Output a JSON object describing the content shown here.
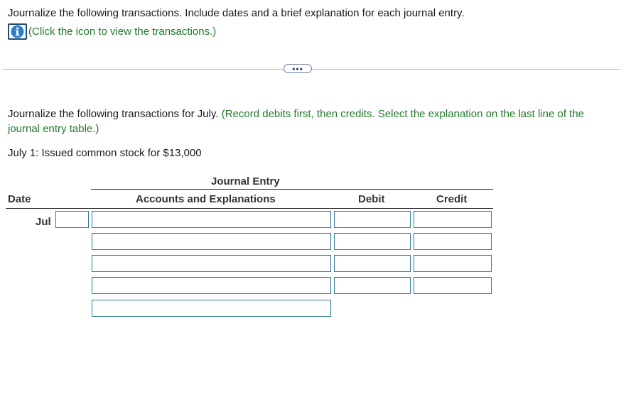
{
  "question": {
    "text": "Journalize the following transactions. Include dates and a brief explanation for each journal entry.",
    "info_link": "(Click the icon to view the transactions.)",
    "info_icon": "info-icon"
  },
  "more_button": {
    "label": "•••"
  },
  "instructions": {
    "text": "Journalize the following transactions for July.",
    "note": "(Record debits first, then credits. Select the explanation on the last line of the journal entry table.)"
  },
  "transaction": {
    "text": "July 1: Issued common stock for $13,000"
  },
  "journal": {
    "title": "Journal Entry",
    "col_date": "Date",
    "col_accounts": "Accounts and Explanations",
    "col_debit": "Debit",
    "col_credit": "Credit",
    "month": "Jul",
    "day_value": "",
    "rows": [
      {
        "account": "",
        "debit": "",
        "credit": ""
      },
      {
        "account": "",
        "debit": "",
        "credit": ""
      },
      {
        "account": "",
        "debit": "",
        "credit": ""
      },
      {
        "account": "",
        "debit": "",
        "credit": ""
      }
    ],
    "explanation": ""
  },
  "colors": {
    "accent_green": "#22792c",
    "input_border": "#2d7a96",
    "icon_blue": "#1f4e79"
  }
}
